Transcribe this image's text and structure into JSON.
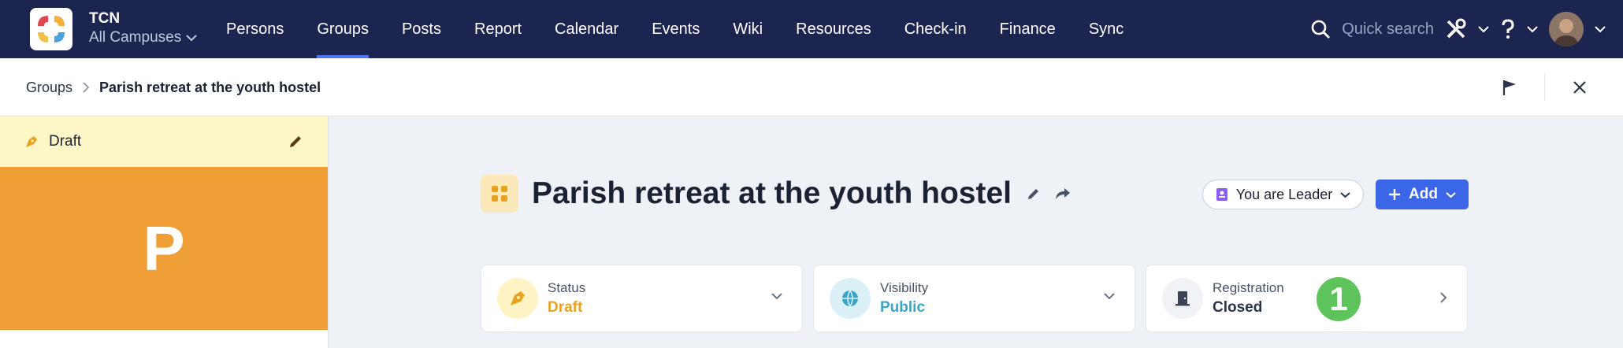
{
  "org": {
    "name": "TCN",
    "campus": "All Campuses"
  },
  "nav": {
    "items": [
      {
        "label": "Persons",
        "active": false
      },
      {
        "label": "Groups",
        "active": true
      },
      {
        "label": "Posts",
        "active": false
      },
      {
        "label": "Report",
        "active": false
      },
      {
        "label": "Calendar",
        "active": false
      },
      {
        "label": "Events",
        "active": false
      },
      {
        "label": "Wiki",
        "active": false
      },
      {
        "label": "Resources",
        "active": false
      },
      {
        "label": "Check-in",
        "active": false
      },
      {
        "label": "Finance",
        "active": false
      },
      {
        "label": "Sync",
        "active": false
      }
    ],
    "quick_search": "Quick search"
  },
  "breadcrumb": {
    "parent": "Groups",
    "current": "Parish retreat at the youth hostel"
  },
  "left_panel": {
    "draft_label": "Draft",
    "cover_letter": "P"
  },
  "group": {
    "title": "Parish retreat at the youth hostel",
    "role_label": "You are Leader",
    "add_label": "Add"
  },
  "cards": {
    "status": {
      "label": "Status",
      "value": "Draft"
    },
    "visibility": {
      "label": "Visibility",
      "value": "Public"
    },
    "registration": {
      "label": "Registration",
      "value": "Closed",
      "badge": "1"
    }
  },
  "colors": {
    "nav_bg": "#1b2550",
    "accent": "#3b66e8",
    "draft": "#e9a21f",
    "public": "#3ba5c9",
    "cover": "#ef9f35",
    "badge": "#5fc35c"
  }
}
